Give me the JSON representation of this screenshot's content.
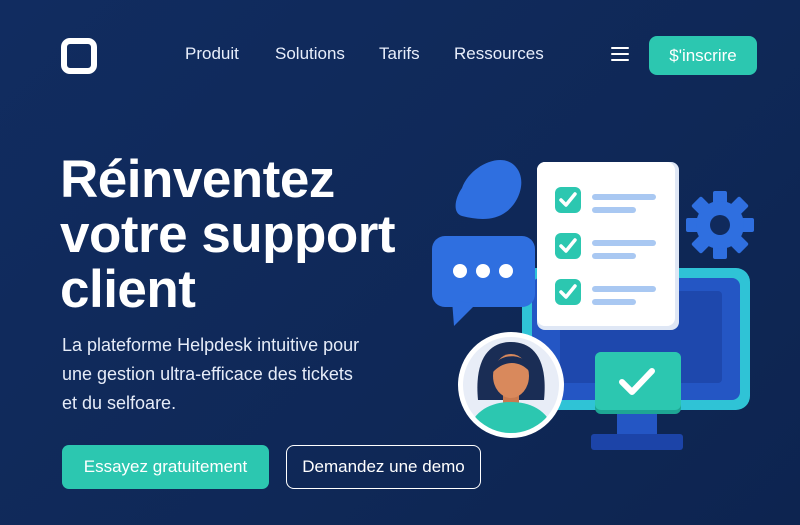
{
  "nav": {
    "logo_icon": "rounded-square-logo",
    "items": [
      "Produit",
      "Solutions",
      "Tarifs",
      "Ressources"
    ],
    "menu_icon": "hamburger-icon",
    "signup_label": "$'inscrire"
  },
  "hero": {
    "title_lines": [
      "Réinventez",
      "votre support",
      "client"
    ],
    "subtitle_lines": [
      "La plateforme Helpdesk intuitive pour",
      "une gestion ultra-efficace des tickets",
      "et du selfoare."
    ],
    "cta_primary": "Essayez gratuitement",
    "cta_secondary": "Demandez une demo"
  },
  "illustration": {
    "icons": [
      "chat-bubble-icon",
      "checklist-document-icon",
      "gear-icon",
      "monitor-icon",
      "user-avatar-icon",
      "checkmark-icon",
      "megaphone-blob-icon"
    ],
    "colors": {
      "background": "#102a5c",
      "accent_teal": "#2cc7b0",
      "accent_blue": "#2f6fe0",
      "light_blue": "#a9c8f2"
    }
  }
}
